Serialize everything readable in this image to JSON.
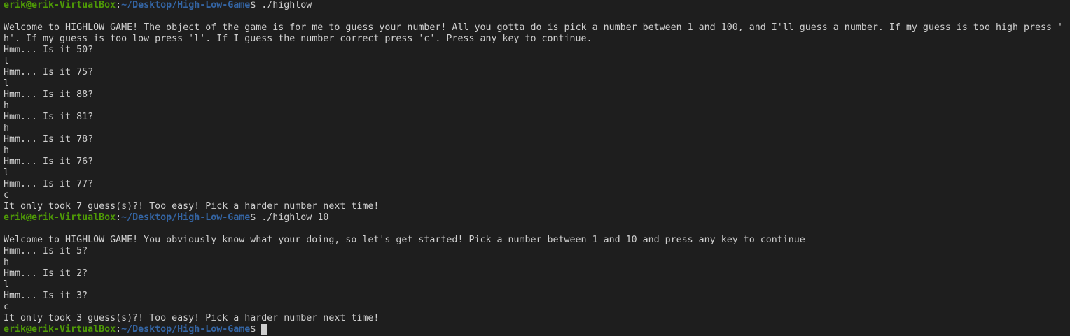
{
  "prompt": {
    "user_host": "erik@erik-VirtualBox",
    "colon": ":",
    "path": "~/Desktop/High-Low-Game",
    "symbol": "$ "
  },
  "lines": [
    {
      "type": "prompt",
      "command": "./highlow"
    },
    {
      "type": "text",
      "text": ""
    },
    {
      "type": "text",
      "text": "Welcome to HIGHLOW GAME! The object of the game is for me to guess your number! All you gotta do is pick a number between 1 and 100, and I'll guess a number. If my guess is too high press '"
    },
    {
      "type": "text",
      "text": "h'. If my guess is too low press 'l'. If I guess the number correct press 'c'. Press any key to continue."
    },
    {
      "type": "text",
      "text": "Hmm... Is it 50?"
    },
    {
      "type": "text",
      "text": "l"
    },
    {
      "type": "text",
      "text": "Hmm... Is it 75?"
    },
    {
      "type": "text",
      "text": "l"
    },
    {
      "type": "text",
      "text": "Hmm... Is it 88?"
    },
    {
      "type": "text",
      "text": "h"
    },
    {
      "type": "text",
      "text": "Hmm... Is it 81?"
    },
    {
      "type": "text",
      "text": "h"
    },
    {
      "type": "text",
      "text": "Hmm... Is it 78?"
    },
    {
      "type": "text",
      "text": "h"
    },
    {
      "type": "text",
      "text": "Hmm... Is it 76?"
    },
    {
      "type": "text",
      "text": "l"
    },
    {
      "type": "text",
      "text": "Hmm... Is it 77?"
    },
    {
      "type": "text",
      "text": "c"
    },
    {
      "type": "text",
      "text": "It only took 7 guess(s)?! Too easy! Pick a harder number next time!"
    },
    {
      "type": "prompt",
      "command": "./highlow 10"
    },
    {
      "type": "text",
      "text": ""
    },
    {
      "type": "text",
      "text": "Welcome to HIGHLOW GAME! You obviously know what your doing, so let's get started! Pick a number between 1 and 10 and press any key to continue"
    },
    {
      "type": "text",
      "text": "Hmm... Is it 5?"
    },
    {
      "type": "text",
      "text": "h"
    },
    {
      "type": "text",
      "text": "Hmm... Is it 2?"
    },
    {
      "type": "text",
      "text": "l"
    },
    {
      "type": "text",
      "text": "Hmm... Is it 3?"
    },
    {
      "type": "text",
      "text": "c"
    },
    {
      "type": "text",
      "text": "It only took 3 guess(s)?! Too easy! Pick a harder number next time!"
    },
    {
      "type": "prompt",
      "command": "",
      "cursor": true
    }
  ]
}
